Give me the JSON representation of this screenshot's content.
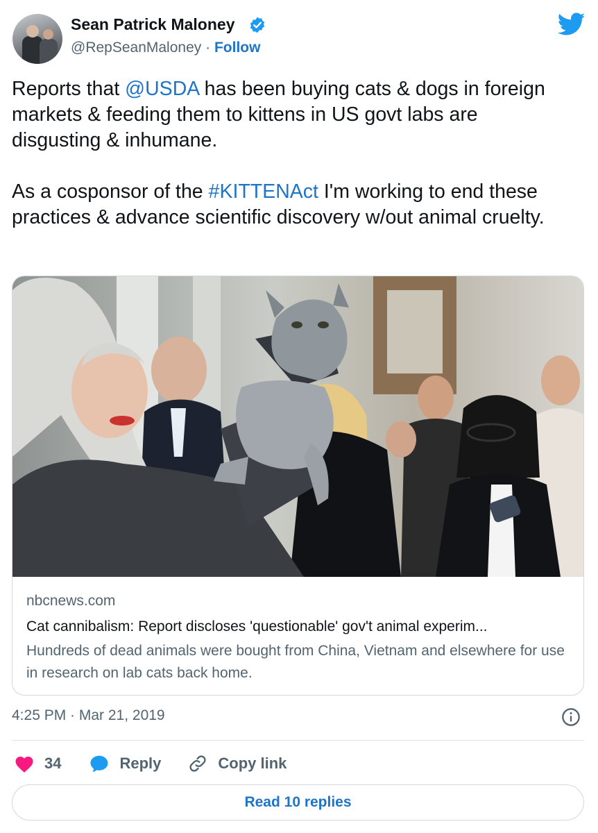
{
  "author": {
    "name": "Sean Patrick Maloney",
    "handle": "@RepSeanMaloney",
    "separator": "·",
    "follow_label": "Follow"
  },
  "tweet": {
    "p1_pre": "Reports that ",
    "p1_mention": "@USDA",
    "p1_post": " has been buying cats & dogs in foreign markets & feeding them to kittens in US govt labs are disgusting & inhumane.",
    "p2_pre": "As a cosponsor of the ",
    "p2_hashtag": "#KITTENAct",
    "p2_post": " I'm working to end these practices & advance scientific discovery w/out animal cruelty."
  },
  "card": {
    "domain": "nbcnews.com",
    "title": "Cat cannibalism: Report discloses 'questionable' gov't animal experim...",
    "description": "Hundreds of dead animals were bought from China, Vietnam and elsewhere for use in research on lab cats back home."
  },
  "timestamp": "4:25 PM · Mar 21, 2019",
  "actions": {
    "like_count": "34",
    "reply_label": "Reply",
    "copy_link_label": "Copy link"
  },
  "read_replies_label": "Read 10 replies",
  "icons": {
    "verified": "verified-badge-icon",
    "bird": "twitter-bird-icon",
    "info": "info-icon",
    "like": "heart-icon",
    "reply": "speech-bubble-icon",
    "copy": "link-icon"
  },
  "colors": {
    "link_blue": "#1d74c9",
    "heart_pink": "#f91880",
    "twitter_blue": "#1d9bf0",
    "muted_text": "#536471"
  }
}
